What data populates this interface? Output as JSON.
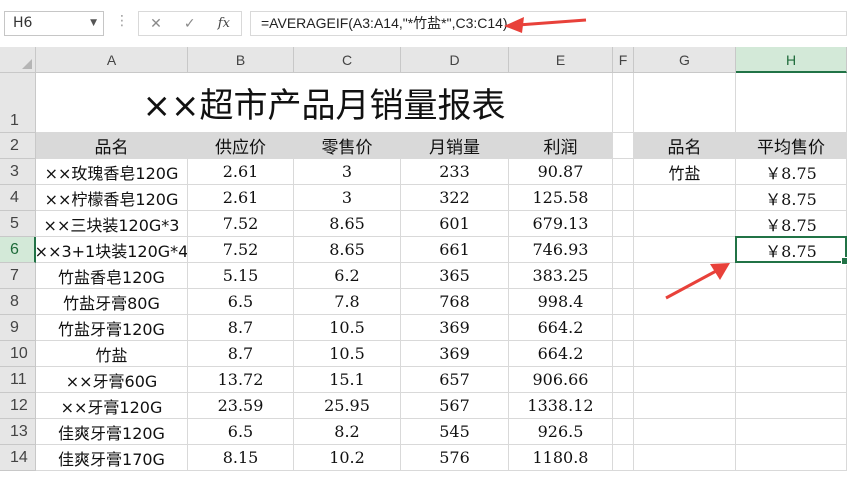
{
  "name_box": "H6",
  "formula": "=AVERAGEIF(A3:A14,\"*竹盐*\",C3:C14)",
  "columns": [
    "A",
    "B",
    "C",
    "D",
    "E",
    "F",
    "G",
    "H"
  ],
  "rows": [
    "1",
    "2",
    "3",
    "4",
    "5",
    "6",
    "7",
    "8",
    "9",
    "10",
    "11",
    "12",
    "13",
    "14"
  ],
  "title": "××超市产品月销量报表",
  "table_headers": [
    "品名",
    "供应价",
    "零售价",
    "月销量",
    "利润"
  ],
  "table": [
    [
      "××玫瑰香皂120G",
      "2.61",
      "3",
      "233",
      "90.87"
    ],
    [
      "××柠檬香皂120G",
      "2.61",
      "3",
      "322",
      "125.58"
    ],
    [
      "××三块装120G*3",
      "7.52",
      "8.65",
      "601",
      "679.13"
    ],
    [
      "××3+1块装120G*4",
      "7.52",
      "8.65",
      "661",
      "746.93"
    ],
    [
      "竹盐香皂120G",
      "5.15",
      "6.2",
      "365",
      "383.25"
    ],
    [
      "竹盐牙膏80G",
      "6.5",
      "7.8",
      "768",
      "998.4"
    ],
    [
      "竹盐牙膏120G",
      "8.7",
      "10.5",
      "369",
      "664.2"
    ],
    [
      "竹盐",
      "8.7",
      "10.5",
      "369",
      "664.2"
    ],
    [
      "××牙膏60G",
      "13.72",
      "15.1",
      "657",
      "906.66"
    ],
    [
      "××牙膏120G",
      "23.59",
      "25.95",
      "567",
      "1338.12"
    ],
    [
      "佳爽牙膏120G",
      "6.5",
      "8.2",
      "545",
      "926.5"
    ],
    [
      "佳爽牙膏170G",
      "8.15",
      "10.2",
      "576",
      "1180.8"
    ]
  ],
  "side_headers": [
    "品名",
    "平均售价"
  ],
  "side_rows": [
    [
      "竹盐",
      "￥8.75"
    ],
    [
      "",
      "￥8.75"
    ],
    [
      "",
      "￥8.75"
    ],
    [
      "",
      "￥8.75"
    ]
  ],
  "colors": {
    "selection": "#217346",
    "header_fill": "#d9d9d9",
    "arrow": "#e8413a"
  }
}
